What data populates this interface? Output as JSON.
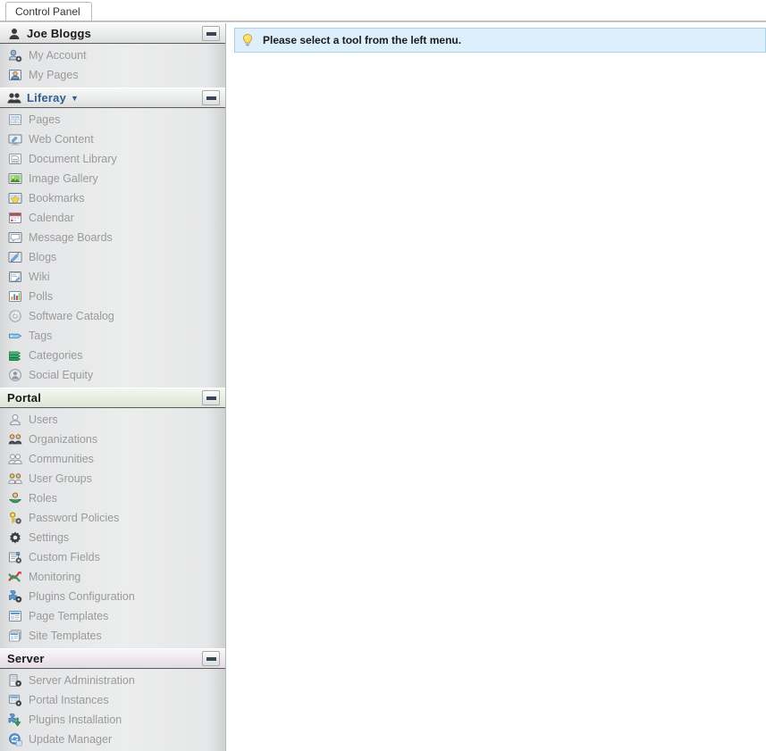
{
  "window": {
    "tab_title": "Control Panel"
  },
  "main": {
    "info_message": "Please select a tool from the left menu.",
    "info_icon": "lightbulb-icon",
    "info_bg": "#ddeffc",
    "info_border": "#a9d4e8"
  },
  "sidebar": {
    "collapse_icon": "minus-icon",
    "sections": [
      {
        "id": "user",
        "title": "Joe Bloggs",
        "icon": "user-icon",
        "tone": "",
        "is_link": false,
        "has_caret": false,
        "items": [
          {
            "label": "My Account",
            "icon": "my-account-icon"
          },
          {
            "label": "My Pages",
            "icon": "my-pages-icon"
          }
        ]
      },
      {
        "id": "liferay",
        "title": "Liferay",
        "icon": "community-icon",
        "tone": "",
        "is_link": true,
        "has_caret": true,
        "caret": "▼",
        "items": [
          {
            "label": "Pages",
            "icon": "pages-icon"
          },
          {
            "label": "Web Content",
            "icon": "web-content-icon"
          },
          {
            "label": "Document Library",
            "icon": "document-library-icon"
          },
          {
            "label": "Image Gallery",
            "icon": "image-gallery-icon"
          },
          {
            "label": "Bookmarks",
            "icon": "bookmarks-icon"
          },
          {
            "label": "Calendar",
            "icon": "calendar-icon"
          },
          {
            "label": "Message Boards",
            "icon": "message-boards-icon"
          },
          {
            "label": "Blogs",
            "icon": "blogs-icon"
          },
          {
            "label": "Wiki",
            "icon": "wiki-icon"
          },
          {
            "label": "Polls",
            "icon": "polls-icon"
          },
          {
            "label": "Software Catalog",
            "icon": "software-catalog-icon"
          },
          {
            "label": "Tags",
            "icon": "tags-icon"
          },
          {
            "label": "Categories",
            "icon": "categories-icon"
          },
          {
            "label": "Social Equity",
            "icon": "social-equity-icon"
          }
        ]
      },
      {
        "id": "portal",
        "title": "Portal",
        "icon": "",
        "tone": "tone-green",
        "is_link": false,
        "has_caret": false,
        "items": [
          {
            "label": "Users",
            "icon": "users-icon"
          },
          {
            "label": "Organizations",
            "icon": "organizations-icon"
          },
          {
            "label": "Communities",
            "icon": "communities-icon"
          },
          {
            "label": "User Groups",
            "icon": "user-groups-icon"
          },
          {
            "label": "Roles",
            "icon": "roles-icon"
          },
          {
            "label": "Password Policies",
            "icon": "password-policies-icon"
          },
          {
            "label": "Settings",
            "icon": "settings-gear-icon"
          },
          {
            "label": "Custom Fields",
            "icon": "custom-fields-icon"
          },
          {
            "label": "Monitoring",
            "icon": "monitoring-icon"
          },
          {
            "label": "Plugins Configuration",
            "icon": "plugins-configuration-icon"
          },
          {
            "label": "Page Templates",
            "icon": "page-templates-icon"
          },
          {
            "label": "Site Templates",
            "icon": "site-templates-icon"
          }
        ]
      },
      {
        "id": "server",
        "title": "Server",
        "icon": "",
        "tone": "tone-pink",
        "is_link": false,
        "has_caret": false,
        "items": [
          {
            "label": "Server Administration",
            "icon": "server-administration-icon"
          },
          {
            "label": "Portal Instances",
            "icon": "portal-instances-icon"
          },
          {
            "label": "Plugins Installation",
            "icon": "plugins-installation-icon"
          },
          {
            "label": "Update Manager",
            "icon": "update-manager-icon"
          }
        ]
      }
    ]
  },
  "colors": {
    "sidebar_bg": "#eceded",
    "nav_text": "#9a9a9a",
    "header_text": "#1a1a1a",
    "link_text": "#2e5f95",
    "portal_tone": "#e9eee3",
    "server_tone": "#efe9ef"
  }
}
